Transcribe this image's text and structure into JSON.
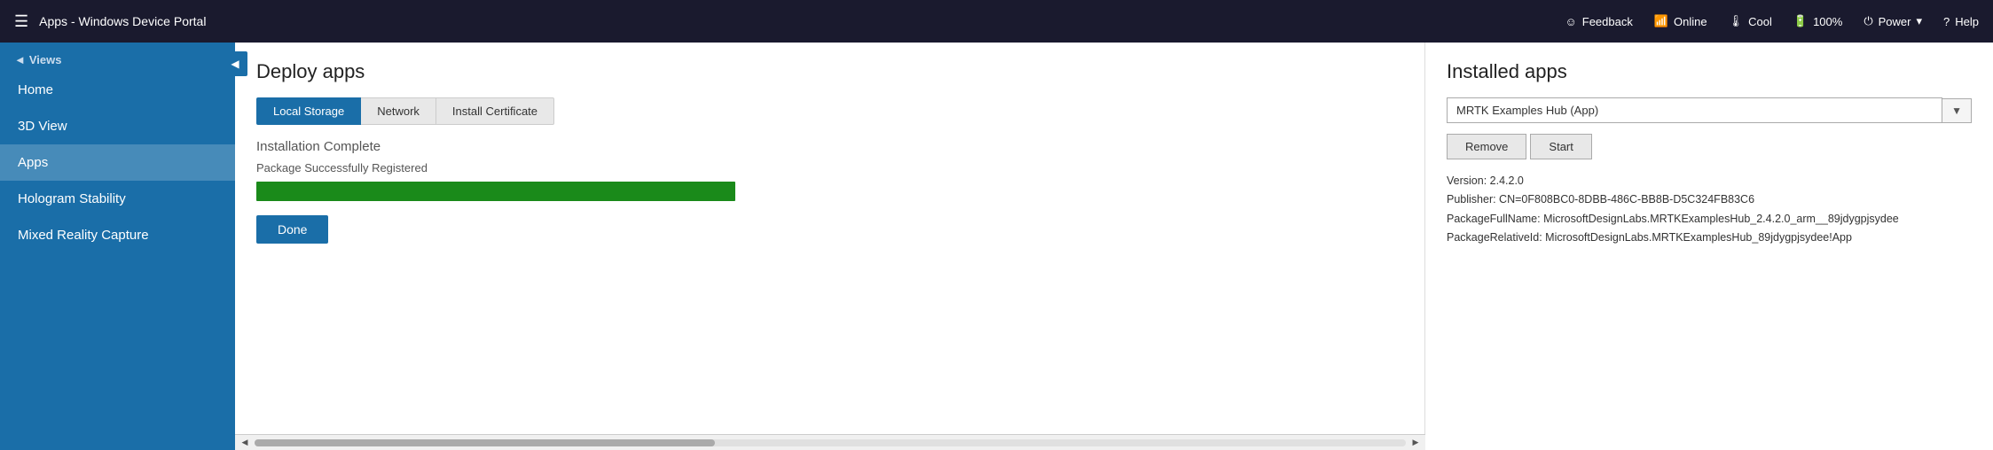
{
  "titlebar": {
    "menu_icon": "☰",
    "title": "Apps - Windows Device Portal",
    "feedback_label": "Feedback",
    "online_label": "Online",
    "cool_label": "Cool",
    "battery_label": "100%",
    "power_label": "Power",
    "help_label": "Help",
    "feedback_icon": "☺",
    "online_icon": "((o))",
    "cool_icon": "🌡",
    "battery_icon": "▬",
    "power_icon": "⏻",
    "help_icon": "?"
  },
  "sidebar": {
    "collapse_icon": "◀",
    "views_label": "◄Views",
    "items": [
      {
        "label": "Home",
        "active": false
      },
      {
        "label": "3D View",
        "active": false
      },
      {
        "label": "Apps",
        "active": true
      },
      {
        "label": "Hologram Stability",
        "active": false
      },
      {
        "label": "Mixed Reality Capture",
        "active": false
      }
    ]
  },
  "deploy_panel": {
    "title": "Deploy apps",
    "tabs": [
      {
        "label": "Local Storage",
        "active": true
      },
      {
        "label": "Network",
        "active": false
      },
      {
        "label": "Install Certificate",
        "active": false
      }
    ],
    "status_label": "Installation Complete",
    "status_message": "Package Successfully Registered",
    "progress_percent": 100,
    "done_button": "Done"
  },
  "installed_panel": {
    "title": "Installed apps",
    "selected_app": "MRTK Examples Hub (App)",
    "dropdown_arrow": "▼",
    "remove_button": "Remove",
    "start_button": "Start",
    "app_info": {
      "version": "Version: 2.4.2.0",
      "publisher": "Publisher: CN=0F808BC0-8DBB-486C-BB8B-D5C324FB83C6",
      "package_full_name": "PackageFullName: MicrosoftDesignLabs.MRTKExamplesHub_2.4.2.0_arm__89jdygpjsydee",
      "package_relative_id": "PackageRelativeId: MicrosoftDesignLabs.MRTKExamplesHub_89jdygpjsydee!App"
    }
  }
}
